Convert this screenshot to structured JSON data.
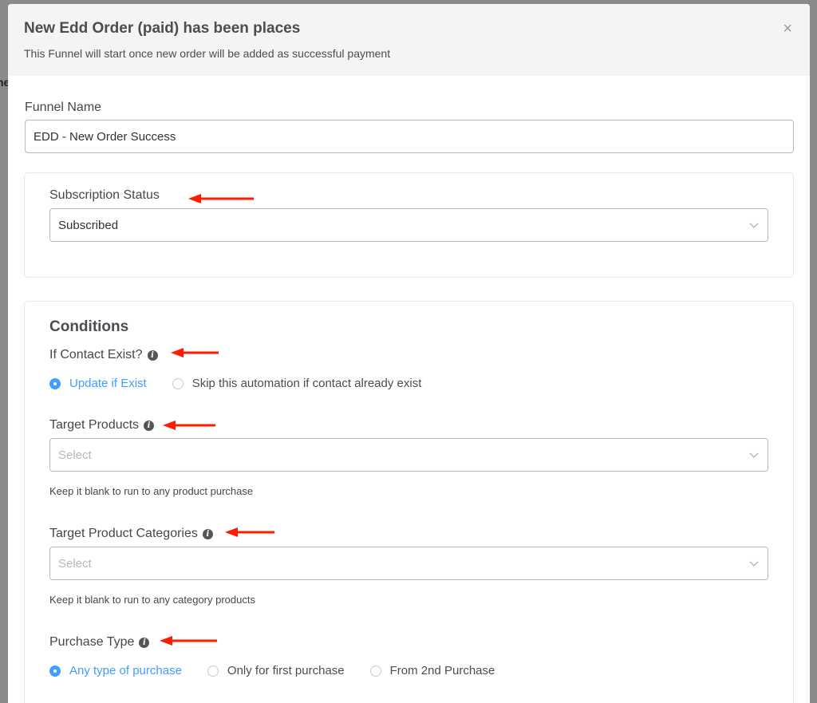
{
  "modal": {
    "title": "New Edd Order (paid) has been places",
    "subtitle": "This Funnel will start once new order will be added as successful payment",
    "close_icon": "×"
  },
  "background_peek": "ne",
  "funnel_name": {
    "label": "Funnel Name",
    "value": "EDD - New Order Success"
  },
  "subscription_status": {
    "label": "Subscription Status",
    "selected": "Subscribed"
  },
  "conditions": {
    "title": "Conditions",
    "if_contact_exist": {
      "label": "If Contact Exist?",
      "options": [
        "Update if Exist",
        "Skip this automation if contact already exist"
      ],
      "selected_index": 0
    },
    "target_products": {
      "label": "Target Products",
      "placeholder": "Select",
      "help": "Keep it blank to run to any product purchase"
    },
    "target_product_categories": {
      "label": "Target Product Categories",
      "placeholder": "Select",
      "help": "Keep it blank to run to any category products"
    },
    "purchase_type": {
      "label": "Purchase Type",
      "options": [
        "Any type of purchase",
        "Only for first purchase",
        "From 2nd Purchase"
      ],
      "selected_index": 0
    }
  },
  "colors": {
    "accent": "#409eff",
    "annotation_arrow": "#ff1a00"
  }
}
